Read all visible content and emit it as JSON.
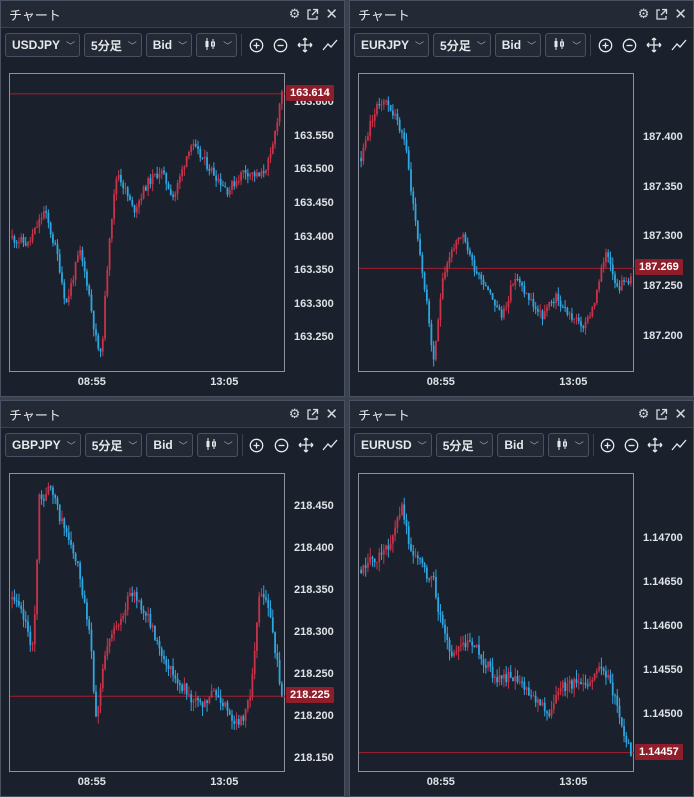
{
  "colors": {
    "up": "#c8334a",
    "down": "#2ea6e0",
    "priceline": "#a3202d",
    "tag": "#8f1d2a"
  },
  "panels": [
    {
      "title": "チャート",
      "symbol": "USDJPY",
      "interval": "5分足",
      "side": "Bid",
      "yticks": [
        "163.600",
        "163.550",
        "163.500",
        "163.450",
        "163.400",
        "163.350",
        "163.300",
        "163.250"
      ],
      "xticks": [
        "08:55",
        "13:05"
      ],
      "price": "163.614",
      "chart_data": {
        "type": "candlestick",
        "ymin": 163.2,
        "ymax": 163.645,
        "current": 163.614,
        "anchors": [
          [
            0,
            163.4
          ],
          [
            0.06,
            163.39
          ],
          [
            0.12,
            163.44
          ],
          [
            0.17,
            163.37
          ],
          [
            0.2,
            163.3
          ],
          [
            0.25,
            163.38
          ],
          [
            0.28,
            163.33
          ],
          [
            0.31,
            163.25
          ],
          [
            0.33,
            163.22
          ],
          [
            0.36,
            163.4
          ],
          [
            0.39,
            163.5
          ],
          [
            0.45,
            163.44
          ],
          [
            0.5,
            163.48
          ],
          [
            0.55,
            163.5
          ],
          [
            0.6,
            163.46
          ],
          [
            0.66,
            163.54
          ],
          [
            0.72,
            163.51
          ],
          [
            0.76,
            163.49
          ],
          [
            0.8,
            163.47
          ],
          [
            0.86,
            163.5
          ],
          [
            0.92,
            163.49
          ],
          [
            0.96,
            163.52
          ],
          [
            1.0,
            163.62
          ]
        ],
        "seed": 11,
        "vol": 0.012
      }
    },
    {
      "title": "チャート",
      "symbol": "EURJPY",
      "interval": "5分足",
      "side": "Bid",
      "yticks": [
        "187.400",
        "187.350",
        "187.300",
        "187.250",
        "187.200"
      ],
      "xticks": [
        "08:55",
        "13:05"
      ],
      "price": "187.269",
      "chart_data": {
        "type": "candlestick",
        "ymin": 187.165,
        "ymax": 187.465,
        "current": 187.269,
        "anchors": [
          [
            0,
            187.38
          ],
          [
            0.04,
            187.42
          ],
          [
            0.08,
            187.44
          ],
          [
            0.11,
            187.43
          ],
          [
            0.16,
            187.4
          ],
          [
            0.2,
            187.32
          ],
          [
            0.25,
            187.22
          ],
          [
            0.27,
            187.17
          ],
          [
            0.3,
            187.26
          ],
          [
            0.34,
            187.29
          ],
          [
            0.38,
            187.3
          ],
          [
            0.42,
            187.27
          ],
          [
            0.47,
            187.25
          ],
          [
            0.52,
            187.22
          ],
          [
            0.57,
            187.26
          ],
          [
            0.62,
            187.24
          ],
          [
            0.67,
            187.22
          ],
          [
            0.72,
            187.24
          ],
          [
            0.78,
            187.22
          ],
          [
            0.83,
            187.21
          ],
          [
            0.87,
            187.24
          ],
          [
            0.91,
            187.29
          ],
          [
            0.95,
            187.25
          ],
          [
            1.0,
            187.26
          ]
        ],
        "seed": 23,
        "vol": 0.008
      }
    },
    {
      "title": "チャート",
      "symbol": "GBPJPY",
      "interval": "5分足",
      "side": "Bid",
      "yticks": [
        "218.450",
        "218.400",
        "218.350",
        "218.300",
        "218.250",
        "218.200",
        "218.150"
      ],
      "xticks": [
        "08:55",
        "13:05"
      ],
      "price": "218.225",
      "chart_data": {
        "type": "candlestick",
        "ymin": 218.135,
        "ymax": 218.49,
        "current": 218.225,
        "anchors": [
          [
            0,
            218.34
          ],
          [
            0.04,
            218.32
          ],
          [
            0.08,
            218.28
          ],
          [
            0.1,
            218.46
          ],
          [
            0.14,
            218.47
          ],
          [
            0.2,
            218.42
          ],
          [
            0.25,
            218.37
          ],
          [
            0.29,
            218.3
          ],
          [
            0.31,
            218.2
          ],
          [
            0.35,
            218.28
          ],
          [
            0.4,
            218.32
          ],
          [
            0.45,
            218.35
          ],
          [
            0.5,
            218.32
          ],
          [
            0.55,
            218.28
          ],
          [
            0.6,
            218.25
          ],
          [
            0.65,
            218.23
          ],
          [
            0.7,
            218.21
          ],
          [
            0.75,
            218.23
          ],
          [
            0.8,
            218.21
          ],
          [
            0.84,
            218.19
          ],
          [
            0.88,
            218.22
          ],
          [
            0.92,
            218.35
          ],
          [
            0.96,
            218.32
          ],
          [
            1.0,
            218.22
          ]
        ],
        "seed": 37,
        "vol": 0.012
      }
    },
    {
      "title": "チャート",
      "symbol": "EURUSD",
      "interval": "5分足",
      "side": "Bid",
      "yticks": [
        "1.14700",
        "1.14650",
        "1.14600",
        "1.14550",
        "1.14500"
      ],
      "xticks": [
        "08:55",
        "13:05"
      ],
      "price": "1.14457",
      "chart_data": {
        "type": "candlestick",
        "ymin": 1.14435,
        "ymax": 1.14775,
        "current": 1.14457,
        "anchors": [
          [
            0,
            1.14665
          ],
          [
            0.06,
            1.1468
          ],
          [
            0.12,
            1.147
          ],
          [
            0.15,
            1.14735
          ],
          [
            0.18,
            1.1469
          ],
          [
            0.22,
            1.1467
          ],
          [
            0.27,
            1.1465
          ],
          [
            0.3,
            1.146
          ],
          [
            0.33,
            1.1457
          ],
          [
            0.38,
            1.1458
          ],
          [
            0.42,
            1.1458
          ],
          [
            0.46,
            1.1456
          ],
          [
            0.5,
            1.1454
          ],
          [
            0.55,
            1.14545
          ],
          [
            0.6,
            1.1453
          ],
          [
            0.65,
            1.1452
          ],
          [
            0.7,
            1.14505
          ],
          [
            0.74,
            1.1453
          ],
          [
            0.78,
            1.14535
          ],
          [
            0.82,
            1.1453
          ],
          [
            0.86,
            1.1454
          ],
          [
            0.9,
            1.14555
          ],
          [
            0.94,
            1.1452
          ],
          [
            0.97,
            1.1448
          ],
          [
            1.0,
            1.14457
          ]
        ],
        "seed": 51,
        "vol": 0.00012
      }
    }
  ]
}
